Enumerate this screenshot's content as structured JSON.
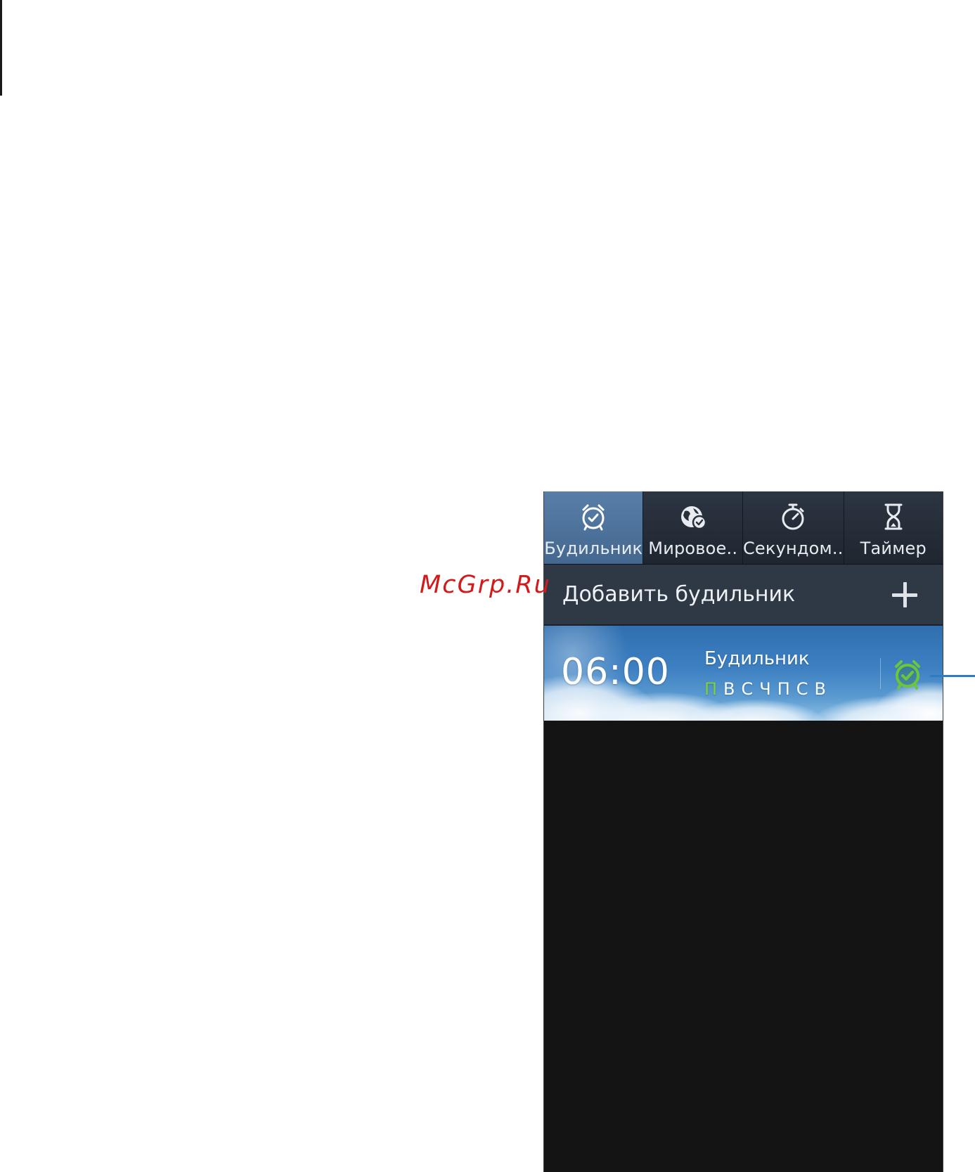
{
  "watermark": "McGrp.Ru",
  "tabs": [
    {
      "label": "Будильник",
      "icon": "alarm-clock-icon",
      "active": true
    },
    {
      "label": "Мировое..",
      "icon": "world-clock-icon",
      "active": false
    },
    {
      "label": "Секундом..",
      "icon": "stopwatch-icon",
      "active": false
    },
    {
      "label": "Таймер",
      "icon": "hourglass-icon",
      "active": false
    }
  ],
  "add_alarm": {
    "label": "Добавить будильник",
    "icon": "plus-icon"
  },
  "alarms": [
    {
      "time": "06:00",
      "name": "Будильник",
      "days": [
        {
          "label": "П",
          "on": true
        },
        {
          "label": "В",
          "on": false
        },
        {
          "label": "С",
          "on": false
        },
        {
          "label": "Ч",
          "on": false
        },
        {
          "label": "П",
          "on": false
        },
        {
          "label": "С",
          "on": false
        },
        {
          "label": "В",
          "on": false
        }
      ],
      "toggle_icon": "alarm-active-icon",
      "enabled": true
    }
  ],
  "colors": {
    "active_tab": "#4f76a0",
    "tab_bar": "#28303b",
    "add_row": "#2f3845",
    "day_on": "#7cd23a",
    "alarm_icon": "#6cc63a",
    "screen_bg": "#141414",
    "callout": "#2e7bc4",
    "watermark": "#d11a1a"
  }
}
